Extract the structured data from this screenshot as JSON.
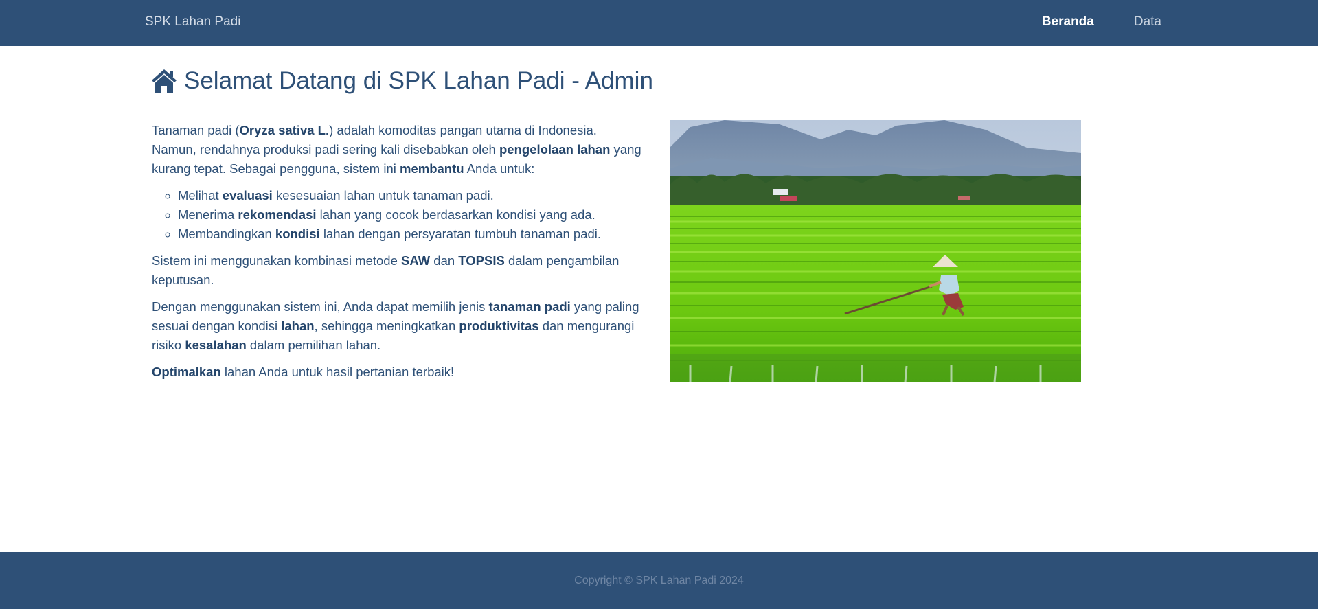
{
  "navbar": {
    "brand": "SPK Lahan Padi",
    "links": [
      {
        "label": "Beranda",
        "active": true
      },
      {
        "label": "Data",
        "active": false
      }
    ]
  },
  "main": {
    "title": "Selamat Datang di SPK Lahan Padi - Admin",
    "title_icon": "home-icon",
    "intro": {
      "t1": "Tanaman padi (",
      "b1": "Oryza sativa L.",
      "t2": ") adalah komoditas pangan utama di Indonesia. Namun, rendahnya produksi padi sering kali disebabkan oleh ",
      "b2": "pengelolaan lahan",
      "t3": " yang kurang tepat. Sebagai pengguna, sistem ini ",
      "b3": "membantu",
      "t4": " Anda untuk:"
    },
    "list": [
      {
        "pre": "Melihat ",
        "bold": "evaluasi",
        "post": " kesesuaian lahan untuk tanaman padi."
      },
      {
        "pre": "Menerima ",
        "bold": "rekomendasi",
        "post": " lahan yang cocok berdasarkan kondisi yang ada."
      },
      {
        "pre": "Membandingkan ",
        "bold": "kondisi",
        "post": " lahan dengan persyaratan tumbuh tanaman padi."
      }
    ],
    "method": {
      "t1": "Sistem ini menggunakan kombinasi metode ",
      "b1": "SAW",
      "t2": " dan ",
      "b2": "TOPSIS",
      "t3": " dalam pengambilan keputusan."
    },
    "benefit": {
      "t1": "Dengan menggunakan sistem ini, Anda dapat memilih jenis ",
      "b1": "tanaman padi",
      "t2": " yang paling sesuai dengan kondisi ",
      "b2": "lahan",
      "t3": ", sehingga meningkatkan ",
      "b3": "produktivitas",
      "t4": " dan mengurangi risiko ",
      "b4": "kesalahan",
      "t5": " dalam pemilihan lahan."
    },
    "closing": {
      "b1": "Optimalkan",
      "t1": " lahan Anda untuk hasil pertanian terbaik!"
    }
  },
  "footer": {
    "copyright": "Copyright © SPK Lahan Padi 2024"
  },
  "colors": {
    "primary": "#2e5077",
    "background": "#ffffff",
    "footer_text": "#6f86a4"
  }
}
